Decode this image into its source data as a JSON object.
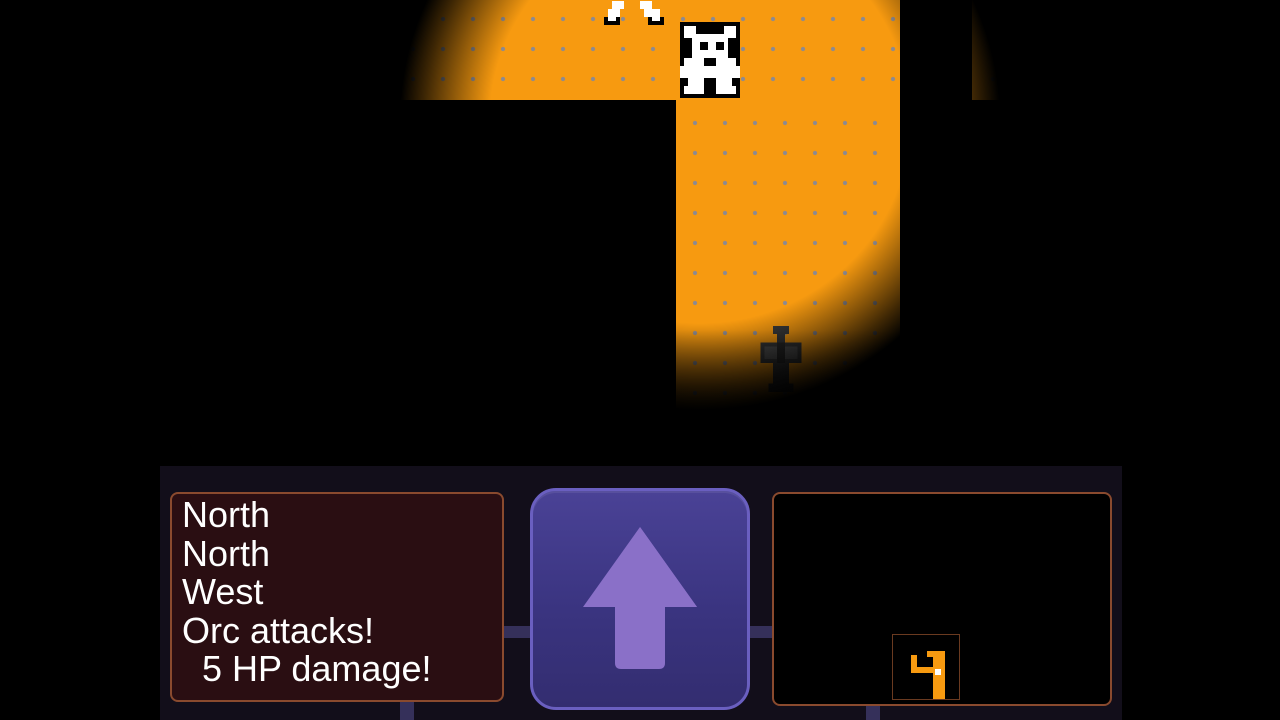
{
  "game": {
    "message_log": [
      "North",
      "North",
      "West",
      "Orc attacks!",
      "  5 HP damage!"
    ],
    "controls": {
      "move_button_icon": "arrow-up-icon"
    },
    "minimap": {
      "marker_icon": "player-marker-icon"
    },
    "sprites": [
      "orc-icon",
      "ally-icon",
      "tombstone-icon"
    ]
  },
  "colors": {
    "floor": "#f79a10",
    "floor_dots": "#8d8a90",
    "hud_background": "#120e1a",
    "message_background": "#2a0e12",
    "panel_border": "#8a4a2e",
    "button": "#3a3480",
    "arrow": "#8a70c8"
  }
}
